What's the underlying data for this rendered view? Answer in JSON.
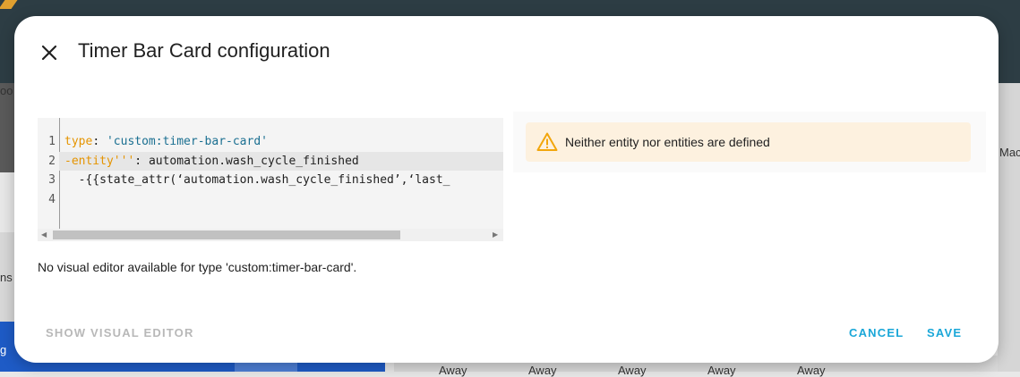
{
  "background": {
    "left_text_1": "oo",
    "left_text_2": "ns",
    "left_text_3": "g",
    "right_text": "Mach",
    "bottom_labels": [
      "Away",
      "Away",
      "Away",
      "Away",
      "Away"
    ]
  },
  "dialog": {
    "title": "Timer Bar Card configuration",
    "editor": {
      "line_numbers": [
        "1",
        "2",
        "3",
        "4"
      ],
      "lines": [
        {
          "key": "type",
          "sep": ": ",
          "value": "'custom:timer-bar-card'"
        },
        {
          "key": "-entity'''",
          "sep": ": ",
          "value": "automation.wash_cycle_finished"
        },
        {
          "text": "  -{{state_attr(‘automation.wash_cycle_finished’,‘last_"
        },
        {
          "text": ""
        }
      ]
    },
    "no_visual_editor_text": "No visual editor available for type 'custom:timer-bar-card'.",
    "warning": {
      "icon": "warning-triangle-icon",
      "text": "Neither entity nor entities are defined",
      "color": "#fdf1df",
      "icon_color": "#f2a60c"
    },
    "buttons": {
      "show_visual_editor": "SHOW VISUAL EDITOR",
      "cancel": "CANCEL",
      "save": "SAVE"
    },
    "accent_color": "#1aa7d8"
  }
}
